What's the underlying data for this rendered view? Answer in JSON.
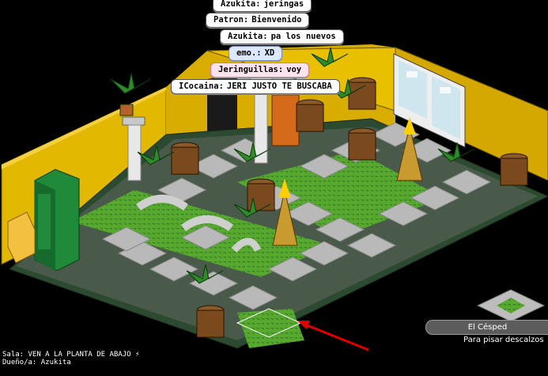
{
  "chat": [
    {
      "name": "Azukita:",
      "message": "jeringas",
      "color": "#ffffff"
    },
    {
      "name": "Patron:",
      "message": "Bienvenido",
      "color": "#ffffff"
    },
    {
      "name": "Azukita:",
      "message": "pa los nuevos",
      "color": "#ffffff"
    },
    {
      "name": "emo.:",
      "message": "XD",
      "color": "#dce8ff"
    },
    {
      "name": "Jeringuillas:",
      "message": "voy",
      "color": "#ffe4f0"
    },
    {
      "name": "ICocaina:",
      "message": "JERI JUSTO TE BUSCABA",
      "color": "#ffffff"
    }
  ],
  "room": {
    "name_label": "Sala: VEN A LA PLANTA DE ABAJO ⚡",
    "owner_label": "Dueño/a: Azukita"
  },
  "selected_item": {
    "name": "El Césped",
    "description": "Para pisar descalzos"
  },
  "colors": {
    "wall_left": "#e2b800",
    "wall_right": "#d4a800",
    "floor_border": "#2f5a3a",
    "tile": "#b8b8b8",
    "grass": "#4a9a2a",
    "arrow": "#e00000"
  }
}
